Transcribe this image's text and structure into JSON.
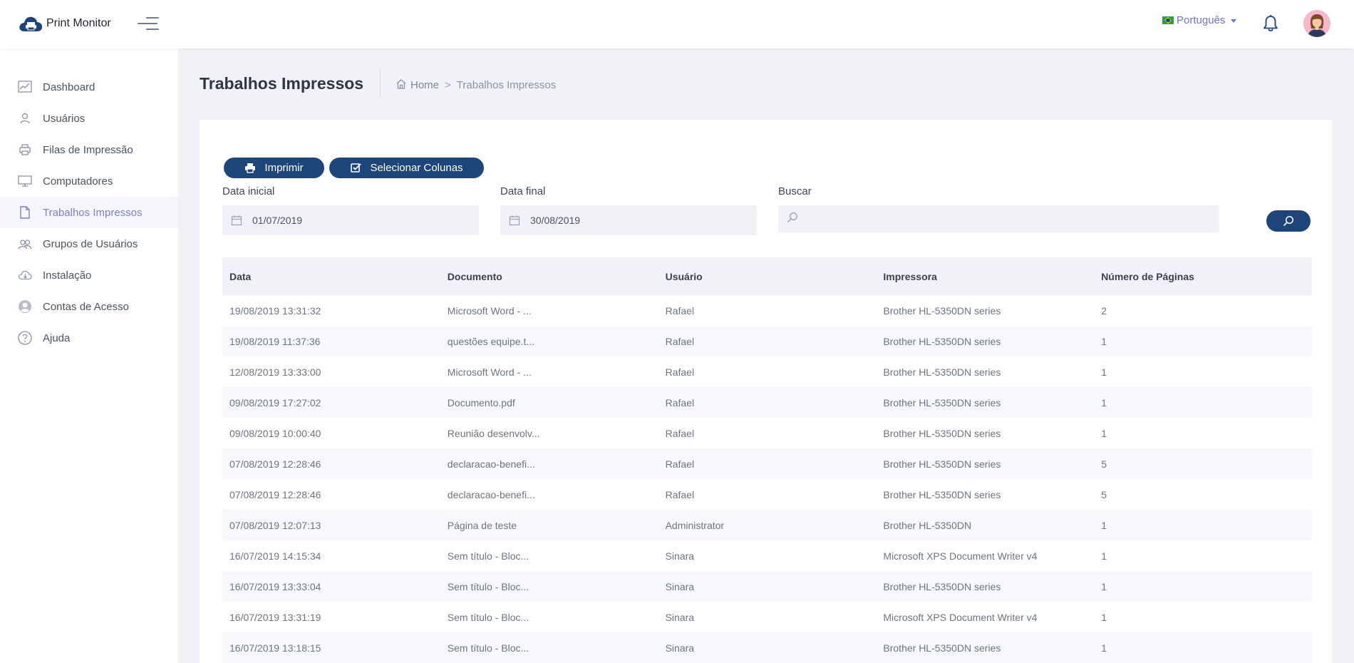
{
  "header": {
    "app_name": "Print Monitor",
    "language": "Português",
    "colors": {
      "primary": "#1d4579",
      "accent": "#7a82d4"
    }
  },
  "sidebar": {
    "items": [
      {
        "label": "Dashboard",
        "icon": "chart-line-icon"
      },
      {
        "label": "Usuários",
        "icon": "user-icon"
      },
      {
        "label": "Filas de Impressão",
        "icon": "printer-icon"
      },
      {
        "label": "Computadores",
        "icon": "monitor-icon"
      },
      {
        "label": "Trabalhos Impressos",
        "icon": "document-icon",
        "active": true
      },
      {
        "label": "Grupos de Usuários",
        "icon": "users-group-icon"
      },
      {
        "label": "Instalação",
        "icon": "cloud-download-icon"
      },
      {
        "label": "Contas de Acesso",
        "icon": "account-circle-icon"
      },
      {
        "label": "Ajuda",
        "icon": "help-icon"
      }
    ]
  },
  "page": {
    "title": "Trabalhos Impressos",
    "breadcrumb": {
      "home": "Home",
      "separator": ">",
      "current": "Trabalhos Impressos"
    }
  },
  "toolbar": {
    "print_label": "Imprimir",
    "select_columns_label": "Selecionar Colunas"
  },
  "filters": {
    "start_date_label": "Data inicial",
    "start_date_value": "01/07/2019",
    "end_date_label": "Data final",
    "end_date_value": "30/08/2019",
    "search_label": "Buscar",
    "search_value": ""
  },
  "table": {
    "columns": [
      "Data",
      "Documento",
      "Usuário",
      "Impressora",
      "Número de Páginas"
    ],
    "rows": [
      [
        "19/08/2019 13:31:32",
        "Microsoft Word - ...",
        "Rafael",
        "Brother HL-5350DN series",
        "2"
      ],
      [
        "19/08/2019 11:37:36",
        "questões equipe.t...",
        "Rafael",
        "Brother HL-5350DN series",
        "1"
      ],
      [
        "12/08/2019 13:33:00",
        "Microsoft Word - ...",
        "Rafael",
        "Brother HL-5350DN series",
        "1"
      ],
      [
        "09/08/2019 17:27:02",
        "Documento.pdf",
        "Rafael",
        "Brother HL-5350DN series",
        "1"
      ],
      [
        "09/08/2019 10:00:40",
        "Reunião desenvolv...",
        "Rafael",
        "Brother HL-5350DN series",
        "1"
      ],
      [
        "07/08/2019 12:28:46",
        "declaracao-benefi...",
        "Rafael",
        "Brother HL-5350DN series",
        "5"
      ],
      [
        "07/08/2019 12:28:46",
        "declaracao-benefi...",
        "Rafael",
        "Brother HL-5350DN series",
        "5"
      ],
      [
        "07/08/2019 12:07:13",
        "Página de teste",
        "Administrator",
        "Brother HL-5350DN",
        "1"
      ],
      [
        "16/07/2019 14:15:34",
        "Sem título - Bloc...",
        "Sinara",
        "Microsoft XPS Document Writer v4",
        "1"
      ],
      [
        "16/07/2019 13:33:04",
        "Sem título - Bloc...",
        "Sinara",
        "Brother HL-5350DN series",
        "1"
      ],
      [
        "16/07/2019 13:31:19",
        "Sem título - Bloc...",
        "Sinara",
        "Microsoft XPS Document Writer v4",
        "1"
      ],
      [
        "16/07/2019 13:18:15",
        "Sem título - Bloc...",
        "Sinara",
        "Brother HL-5350DN series",
        "1"
      ]
    ]
  }
}
